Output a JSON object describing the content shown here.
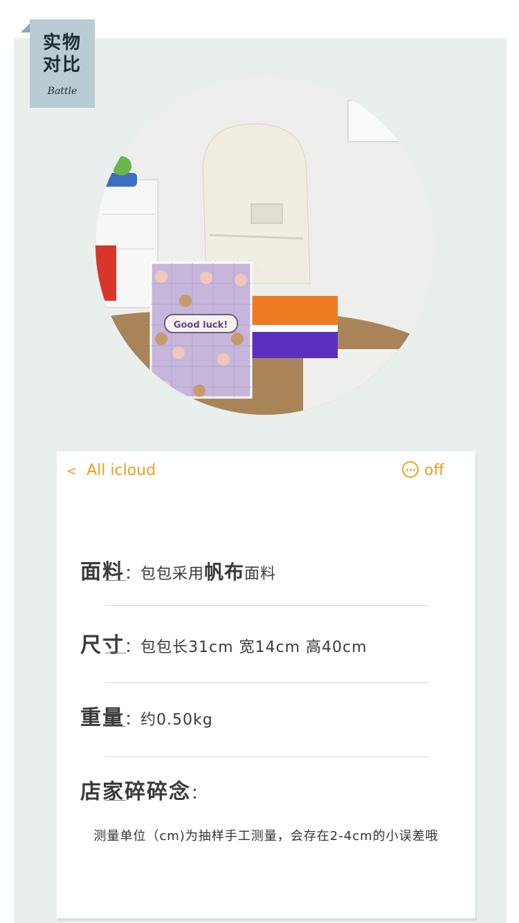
{
  "badge": {
    "title_line1": "实物",
    "title_line2": "对比",
    "subtitle": "Battle"
  },
  "notebook": {
    "text": "Good luck!"
  },
  "nav": {
    "back_chevron": "<",
    "back_label": "All icloud",
    "more_label": "off",
    "more_icon": "ellipsis-circle-icon"
  },
  "specs": {
    "material": {
      "label": "面料",
      "value_pre": "包包采用",
      "value_bold": "帆布",
      "value_post": "面料"
    },
    "size": {
      "label": "尺寸",
      "value": "包包长31cm 宽14cm 高40cm"
    },
    "weight": {
      "label": "重量",
      "value": "约0.50kg"
    },
    "notes": {
      "label": "店家碎碎念"
    }
  },
  "footer_note": "测量单位（cm)为抽样手工测量，会存在2-4cm的小误差哦",
  "colors": {
    "accent": "#e8a11f",
    "panel": "#e9efec",
    "badge": "#b9cbd3"
  }
}
